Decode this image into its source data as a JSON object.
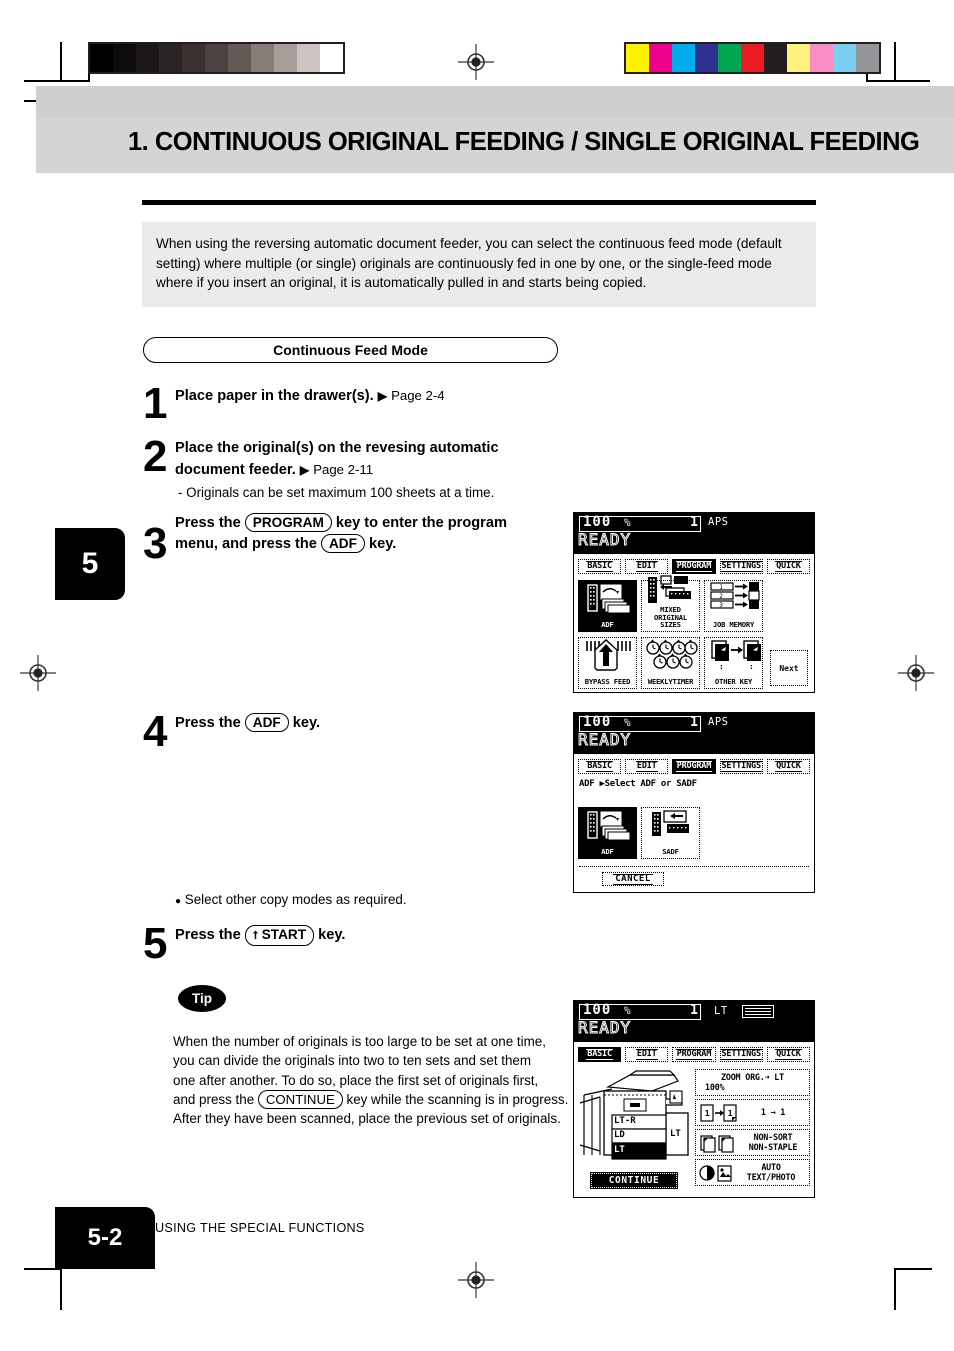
{
  "header": {
    "title": "1. CONTINUOUS ORIGINAL FEEDING  /  SINGLE ORIGINAL FEEDING"
  },
  "intro": {
    "text": "When using the reversing automatic document feeder, you can select the continuous feed mode (default setting) where multiple (or single) originals are continuously fed in one by one, or the single-feed mode where if you insert an original, it is automatically pulled in and starts being copied."
  },
  "section": {
    "pill_label": "Continuous Feed Mode"
  },
  "chapter_tab": "5",
  "steps": [
    {
      "num": "1",
      "text_before": "Place paper in the drawer(s).",
      "arrow": "▶",
      "page_ref": "Page 2-4"
    },
    {
      "num": "2",
      "line1": "Place  the  original(s)  on  the  revesing  automatic",
      "line2_before": "document feeder.",
      "arrow": "▶",
      "page_ref": "Page  2-11",
      "note": "- Originals can be set maximum 100 sheets at a time."
    },
    {
      "num": "3",
      "p1": "Press  the",
      "key1": "PROGRAM",
      "p2": "key  to  enter  the  program",
      "p3": "menu, and press the",
      "key2": "ADF",
      "p4": "key."
    },
    {
      "num": "4",
      "p1": "Press the",
      "key1": "ADF",
      "p2": "key.",
      "bullet": "●",
      "bullet_text": "Select other copy modes as required."
    },
    {
      "num": "5",
      "p1": "Press the",
      "key1": "START",
      "key1_glyph": "⭡",
      "p2": "key."
    }
  ],
  "tip": {
    "badge": "Tip",
    "line1": "When the number of originals is too large to be set at one time,",
    "line2": "you can divide the originals into two to ten sets and set them",
    "line3": "one after another.  To do so, place the first set of originals first,",
    "line4_a": "and press the",
    "line4_key": "CONTINUE",
    "line4_b": "key while the scanning is in progress.",
    "line5": "After they have been scanned, place the previous set of originals."
  },
  "lcd_common": {
    "ratio": "100",
    "percent": "%",
    "count": "1",
    "ready": "READY",
    "tabs": [
      "BASIC",
      "EDIT",
      "PROGRAM",
      "SETTINGS",
      "QUICK"
    ]
  },
  "lcd_panels": [
    {
      "id": "program-menu",
      "paper_mode": "APS",
      "paper_icon": false,
      "selected_tab": "PROGRAM",
      "buttons": [
        {
          "label": "ADF",
          "icon": "adf-icon",
          "selected": true
        },
        {
          "label": "MIXED\nORIGINAL SIZES",
          "icon": "mixed-original-sizes-icon",
          "selected": false
        },
        {
          "label": "JOB MEMORY",
          "icon": "job-memory-icon",
          "selected": false
        },
        {
          "label": "BYPASS FEED",
          "icon": "bypass-feed-icon",
          "selected": false
        },
        {
          "label": "WEEKLYTIMER",
          "icon": "weekly-timer-icon",
          "selected": false
        },
        {
          "label": "OTHER  KEY",
          "icon": "other-key-icon",
          "selected": false
        }
      ],
      "next_label": "Next"
    },
    {
      "id": "adf-select",
      "paper_mode": "APS",
      "paper_icon": false,
      "selected_tab": "PROGRAM",
      "hint": "ADF  ▶Select ADF or SADF",
      "buttons": [
        {
          "label": "ADF",
          "icon": "adf-icon",
          "selected": true
        },
        {
          "label": "SADF",
          "icon": "sadf-icon",
          "selected": false
        }
      ],
      "cancel_label": "CANCEL"
    },
    {
      "id": "basic-continue",
      "paper_mode": "LT",
      "paper_icon": true,
      "selected_tab": "BASIC",
      "drawers": [
        "LT-R",
        "LD",
        "LT"
      ],
      "drawer_selected": "LT",
      "tray_label": "LT",
      "continue_label": "CONTINUE",
      "options": [
        {
          "name": "zoom-option",
          "line1": "ZOOM  ORG.➜ LT",
          "line2": "100%"
        },
        {
          "name": "duplex-option",
          "line1": "1 → 1",
          "line2": ""
        },
        {
          "name": "finishing-option",
          "line1": "NON-SORT",
          "line2": "NON-STAPLE"
        },
        {
          "name": "exposure-option",
          "line1": "AUTO",
          "line2": "TEXT/PHOTO"
        }
      ]
    }
  ],
  "footer": {
    "page_number": "5-2",
    "label": "USING THE SPECIAL FUNCTIONS"
  },
  "calibration": {
    "gray_swatches": [
      "#000000",
      "#0d0a0a",
      "#1c1717",
      "#2b2424",
      "#3a3030",
      "#4c4040",
      "#665a57",
      "#887d79",
      "#a89d98",
      "#cdc4c2",
      "#ffffff"
    ],
    "color_swatches": [
      "#fff200",
      "#ec008c",
      "#00aeef",
      "#2e3192",
      "#00a651",
      "#ed1c24",
      "#231f20",
      "#fff27f",
      "#f98ec4",
      "#7ccdf2",
      "#939598"
    ]
  }
}
